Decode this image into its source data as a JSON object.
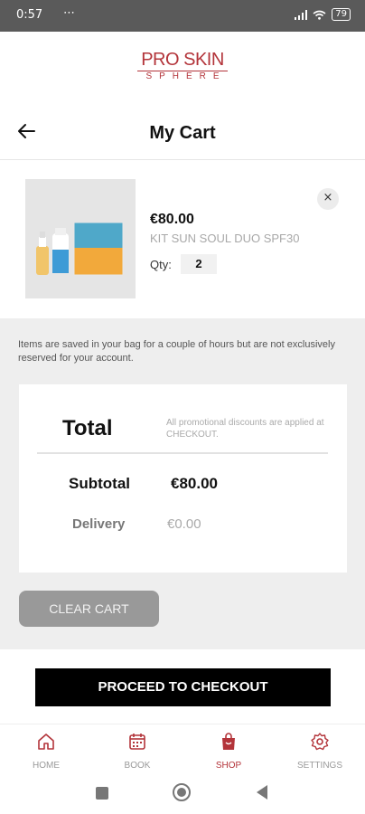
{
  "status_bar": {
    "time": "0:57",
    "dots": "⋯",
    "battery": "79"
  },
  "brand": {
    "line1": "PRO SKIN",
    "line2": "SPHERE"
  },
  "header": {
    "title": "My Cart"
  },
  "cart_item": {
    "price": "€80.00",
    "name": "KIT SUN SOUL DUO SPF30",
    "qty_label": "Qty:",
    "qty_value": "2",
    "remove_symbol": "×"
  },
  "note": "Items are saved in your bag for a couple of hours but are not exclusively reserved for your account.",
  "totals": {
    "total_label": "Total",
    "promo_note": "All promotional discounts are applied at CHECKOUT.",
    "subtotal_label": "Subtotal",
    "subtotal_value": "€80.00",
    "delivery_label": "Delivery",
    "delivery_value": "€0.00"
  },
  "buttons": {
    "clear_cart": "CLEAR CART",
    "checkout": "PROCEED TO CHECKOUT"
  },
  "nav": [
    {
      "label": "HOME",
      "icon": "home-icon"
    },
    {
      "label": "BOOK",
      "icon": "calendar-icon"
    },
    {
      "label": "SHOP",
      "icon": "shopping-bag-icon",
      "active": true
    },
    {
      "label": "SETTINGS",
      "icon": "gear-icon"
    }
  ],
  "colors": {
    "brand": "#b3343a",
    "checkout_bg": "#000000",
    "clear_bg": "#999999"
  }
}
